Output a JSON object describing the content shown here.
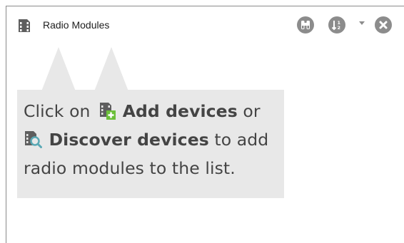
{
  "header": {
    "title": "Radio Modules",
    "icons": {
      "title": "radio-module-icon",
      "binoculars": "binoculars-icon",
      "sort": "sort-icon",
      "close": "close-icon"
    }
  },
  "tooltip": {
    "intro": "Click on",
    "add_label": "Add devices",
    "or_text": "or",
    "discover_label": "Discover devices",
    "suffix_1": "to add",
    "suffix_2": "radio modules to the list."
  },
  "colors": {
    "icon_gray": "#8c8c8c",
    "tooltip_bg": "#e8e8e8",
    "text": "#444444",
    "add_accent": "#6cbf3a",
    "discover_accent": "#5aa9b5"
  }
}
